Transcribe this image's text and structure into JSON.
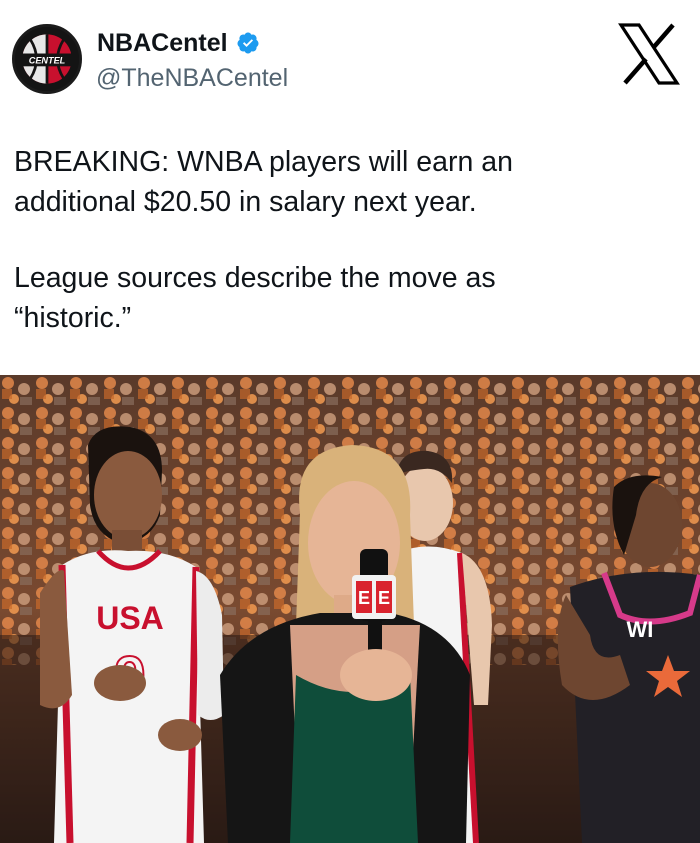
{
  "account": {
    "display_name": "NBACentel",
    "handle": "@TheNBACentel",
    "verified": true,
    "avatar_text": "CENTEL",
    "verified_color": "#1d9bf0"
  },
  "icons": {
    "platform_logo": "x-logo-icon",
    "verified_badge": "verified-badge-icon",
    "microphone_logo": "espn-logo"
  },
  "tweet": {
    "line1": "BREAKING: WNBA players will earn an",
    "line2": "additional $20.50 in salary next year.",
    "line3": "League sources describe the move as",
    "line4": "“historic.”"
  },
  "photo": {
    "jersey_left_text": "USA",
    "jersey_left_number": "9"
  }
}
